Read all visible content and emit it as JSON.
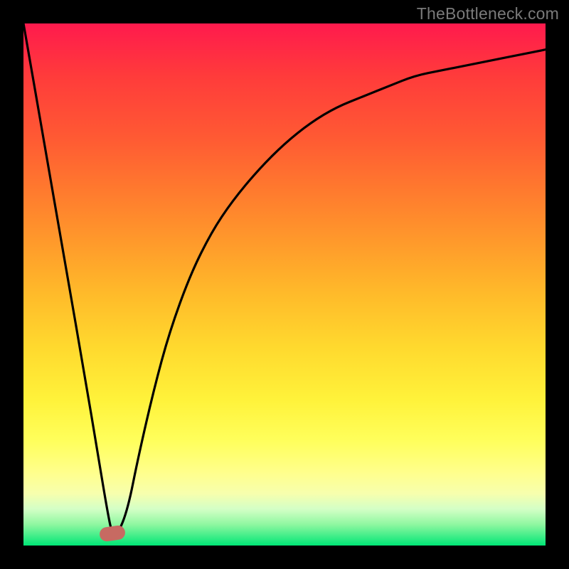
{
  "watermark": "TheBottleneck.com",
  "colors": {
    "frame": "#000000",
    "watermark": "#7a7a7a",
    "marker": "#c76a62",
    "curve": "#000000"
  },
  "chart_data": {
    "type": "line",
    "title": "",
    "xlabel": "",
    "ylabel": "",
    "xlim": [
      0,
      100
    ],
    "ylim": [
      0,
      100
    ],
    "grid": false,
    "legend": false,
    "background_gradient": {
      "top": "#ff1a4d",
      "bottom": "#00e676"
    },
    "series": [
      {
        "name": "bottleneck-curve",
        "x": [
          0,
          4,
          8,
          12,
          14,
          16,
          17,
          18,
          20,
          22,
          25,
          28,
          32,
          36,
          40,
          45,
          50,
          55,
          60,
          65,
          70,
          75,
          80,
          85,
          90,
          95,
          100
        ],
        "y": [
          100,
          77,
          54,
          31,
          19,
          7,
          2,
          2,
          7,
          17,
          30,
          41,
          52,
          60,
          66,
          72,
          77,
          81,
          84,
          86,
          88,
          90,
          91,
          92,
          93,
          94,
          95
        ]
      }
    ],
    "marker": {
      "x": 17,
      "y": 2,
      "label": ""
    }
  }
}
